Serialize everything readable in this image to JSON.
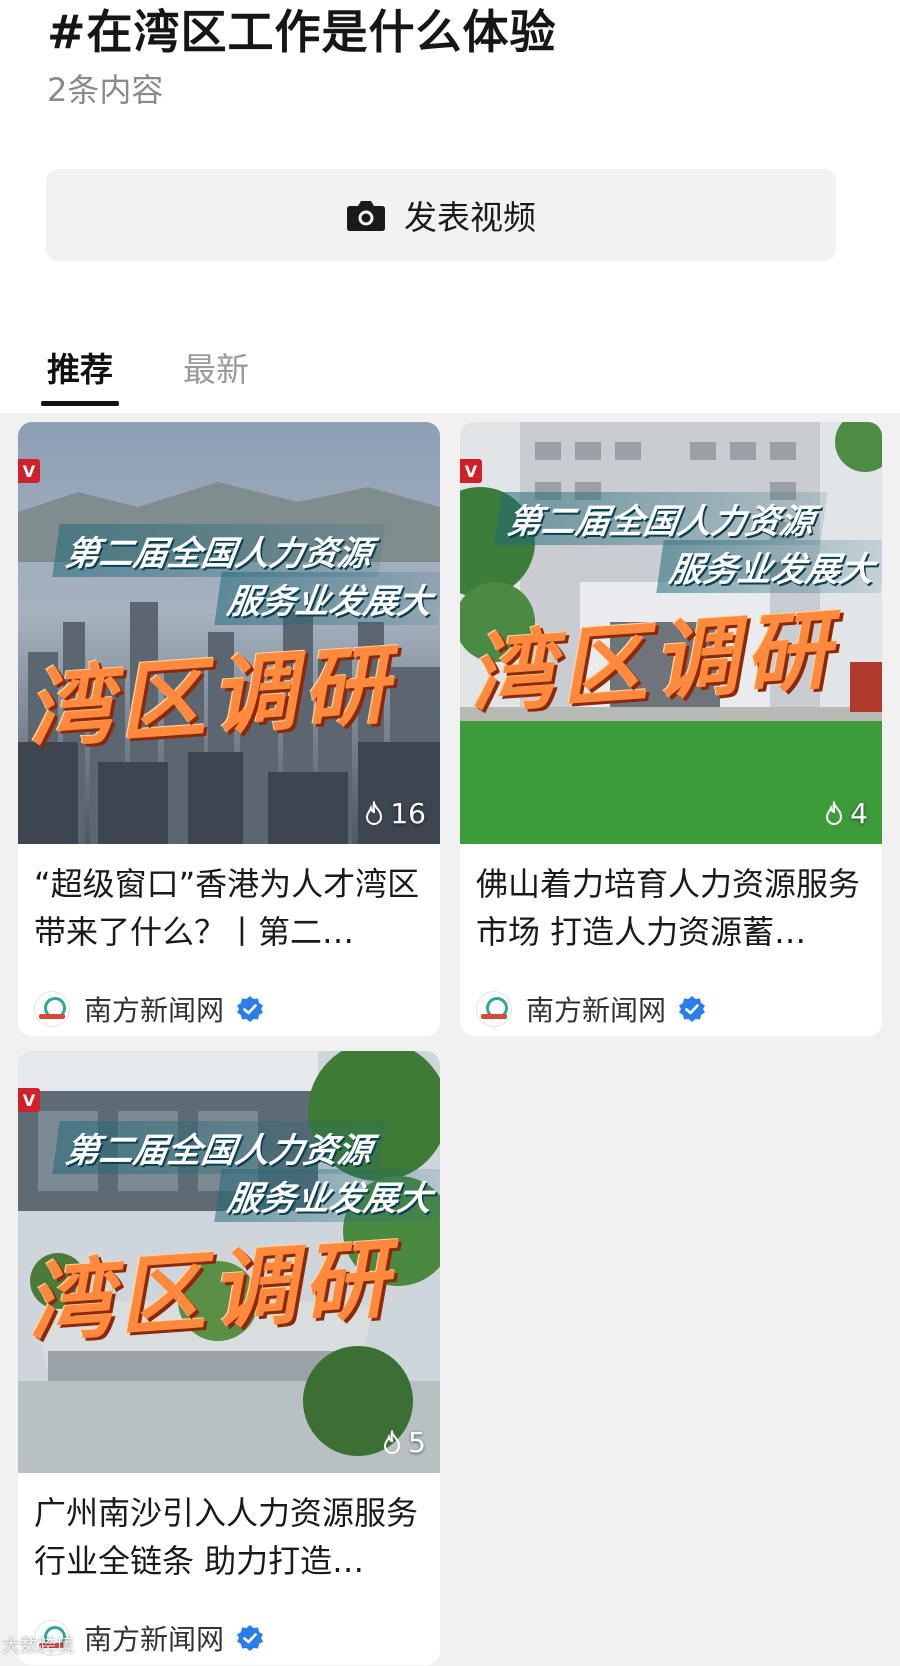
{
  "topic": {
    "title": "#在湾区工作是什么体验",
    "count": "2条内容"
  },
  "post_button": {
    "label": "发表视频",
    "icon": "camera-icon"
  },
  "tabs": [
    {
      "label": "推荐",
      "active": true
    },
    {
      "label": "最新",
      "active": false
    }
  ],
  "cards": [
    {
      "badge": "V",
      "banner_line1": "第二届全国人力资源",
      "banner_line2": "服务业发展大",
      "big_title": "湾区调研",
      "likes": "16",
      "title": "“超级窗口”香港为人才湾区带来了什么？丨第二…",
      "author": "南方新闻网",
      "colors": {
        "sky": "#a9b6c6",
        "ground": "#5a6572"
      }
    },
    {
      "badge": "V",
      "banner_line1": "第二届全国人力资源",
      "banner_line2": "服务业发展大",
      "big_title": "湾区调研",
      "likes": "4",
      "title": "佛山着力培育人力资源服务市场 打造人力资源蓄…",
      "author": "南方新闻网",
      "colors": {
        "sky": "#d9dde2",
        "ground": "#3f9a3c"
      }
    },
    {
      "badge": "V",
      "banner_line1": "第二届全国人力资源",
      "banner_line2": "服务业发展大",
      "big_title": "湾区调研",
      "likes": "5",
      "title": "广州南沙引入人力资源服务行业全链条 助力打造…",
      "author": "南方新闻网",
      "colors": {
        "sky": "#c9d2d8",
        "ground": "#4d7a3e"
      }
    }
  ],
  "watermark": "大数跨境"
}
